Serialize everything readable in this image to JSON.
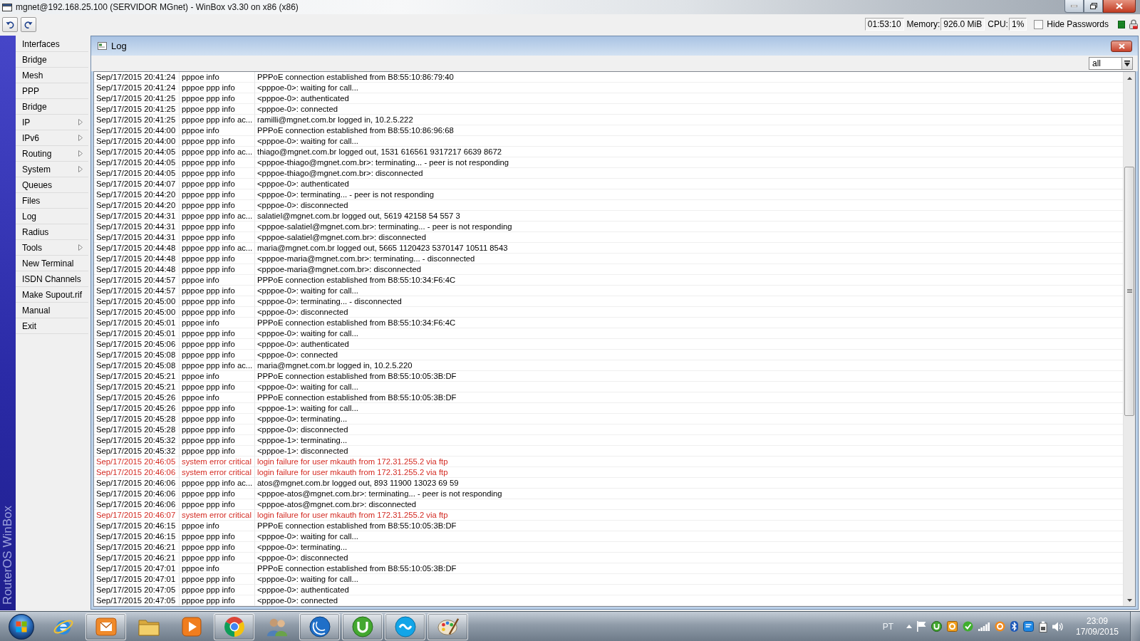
{
  "window": {
    "title": "mgnet@192.168.25.100 (SERVIDOR MGnet) - WinBox v3.30 on x86 (x86)"
  },
  "toolbar": {
    "uptime": "01:53:10",
    "memory_label": "Memory:",
    "memory": "926.0 MiB",
    "cpu_label": "CPU:",
    "cpu": "1%",
    "hide_passwords": {
      "label": "Hide Passwords",
      "checked": false
    }
  },
  "sidebar": {
    "banner": "RouterOS WinBox",
    "items": [
      {
        "label": "Interfaces",
        "submenu": false
      },
      {
        "label": "Bridge",
        "submenu": false
      },
      {
        "label": "Mesh",
        "submenu": false
      },
      {
        "label": "PPP",
        "submenu": false
      },
      {
        "label": "Bridge",
        "submenu": false
      },
      {
        "label": "IP",
        "submenu": true
      },
      {
        "label": "IPv6",
        "submenu": true
      },
      {
        "label": "Routing",
        "submenu": true
      },
      {
        "label": "System",
        "submenu": true
      },
      {
        "label": "Queues",
        "submenu": false
      },
      {
        "label": "Files",
        "submenu": false
      },
      {
        "label": "Log",
        "submenu": false
      },
      {
        "label": "Radius",
        "submenu": false
      },
      {
        "label": "Tools",
        "submenu": true
      },
      {
        "label": "New Terminal",
        "submenu": false
      },
      {
        "label": "ISDN Channels",
        "submenu": false
      },
      {
        "label": "Make Supout.rif",
        "submenu": false
      },
      {
        "label": "Manual",
        "submenu": false
      },
      {
        "label": "Exit",
        "submenu": false
      }
    ]
  },
  "log_window": {
    "title": "Log",
    "filter": {
      "value": "all"
    },
    "table": {
      "rows": [
        {
          "kind": "info",
          "cells": [
            "Sep/17/2015 20:41:24",
            "pppoe info",
            "PPPoE connection established from B8:55:10:86:79:40"
          ]
        },
        {
          "kind": "info",
          "cells": [
            "Sep/17/2015 20:41:24",
            "pppoe ppp info",
            "<pppoe-0>: waiting for call..."
          ]
        },
        {
          "kind": "info",
          "cells": [
            "Sep/17/2015 20:41:25",
            "pppoe ppp info",
            "<pppoe-0>: authenticated"
          ]
        },
        {
          "kind": "info",
          "cells": [
            "Sep/17/2015 20:41:25",
            "pppoe ppp info",
            "<pppoe-0>: connected"
          ]
        },
        {
          "kind": "info",
          "cells": [
            "Sep/17/2015 20:41:25",
            "pppoe ppp info ac...",
            "ramilli@mgnet.com.br logged in, 10.2.5.222"
          ]
        },
        {
          "kind": "info",
          "cells": [
            "Sep/17/2015 20:44:00",
            "pppoe info",
            "PPPoE connection established from B8:55:10:86:96:68"
          ]
        },
        {
          "kind": "info",
          "cells": [
            "Sep/17/2015 20:44:00",
            "pppoe ppp info",
            "<pppoe-0>: waiting for call..."
          ]
        },
        {
          "kind": "info",
          "cells": [
            "Sep/17/2015 20:44:05",
            "pppoe ppp info ac...",
            "thiago@mgnet.com.br logged out, 1531 616561 9317217 6639 8672"
          ]
        },
        {
          "kind": "info",
          "cells": [
            "Sep/17/2015 20:44:05",
            "pppoe ppp info",
            "<pppoe-thiago@mgnet.com.br>: terminating... - peer is not responding"
          ]
        },
        {
          "kind": "info",
          "cells": [
            "Sep/17/2015 20:44:05",
            "pppoe ppp info",
            "<pppoe-thiago@mgnet.com.br>: disconnected"
          ]
        },
        {
          "kind": "info",
          "cells": [
            "Sep/17/2015 20:44:07",
            "pppoe ppp info",
            "<pppoe-0>: authenticated"
          ]
        },
        {
          "kind": "info",
          "cells": [
            "Sep/17/2015 20:44:20",
            "pppoe ppp info",
            "<pppoe-0>: terminating... - peer is not responding"
          ]
        },
        {
          "kind": "info",
          "cells": [
            "Sep/17/2015 20:44:20",
            "pppoe ppp info",
            "<pppoe-0>: disconnected"
          ]
        },
        {
          "kind": "info",
          "cells": [
            "Sep/17/2015 20:44:31",
            "pppoe ppp info ac...",
            "salatiel@mgnet.com.br logged out, 5619 42158 54 557 3"
          ]
        },
        {
          "kind": "info",
          "cells": [
            "Sep/17/2015 20:44:31",
            "pppoe ppp info",
            "<pppoe-salatiel@mgnet.com.br>: terminating... - peer is not responding"
          ]
        },
        {
          "kind": "info",
          "cells": [
            "Sep/17/2015 20:44:31",
            "pppoe ppp info",
            "<pppoe-salatiel@mgnet.com.br>: disconnected"
          ]
        },
        {
          "kind": "info",
          "cells": [
            "Sep/17/2015 20:44:48",
            "pppoe ppp info ac...",
            "maria@mgnet.com.br logged out, 5665 1120423 5370147 10511 8543"
          ]
        },
        {
          "kind": "info",
          "cells": [
            "Sep/17/2015 20:44:48",
            "pppoe ppp info",
            "<pppoe-maria@mgnet.com.br>: terminating... - disconnected"
          ]
        },
        {
          "kind": "info",
          "cells": [
            "Sep/17/2015 20:44:48",
            "pppoe ppp info",
            "<pppoe-maria@mgnet.com.br>: disconnected"
          ]
        },
        {
          "kind": "info",
          "cells": [
            "Sep/17/2015 20:44:57",
            "pppoe info",
            "PPPoE connection established from B8:55:10:34:F6:4C"
          ]
        },
        {
          "kind": "info",
          "cells": [
            "Sep/17/2015 20:44:57",
            "pppoe ppp info",
            "<pppoe-0>: waiting for call..."
          ]
        },
        {
          "kind": "info",
          "cells": [
            "Sep/17/2015 20:45:00",
            "pppoe ppp info",
            "<pppoe-0>: terminating... - disconnected"
          ]
        },
        {
          "kind": "info",
          "cells": [
            "Sep/17/2015 20:45:00",
            "pppoe ppp info",
            "<pppoe-0>: disconnected"
          ]
        },
        {
          "kind": "info",
          "cells": [
            "Sep/17/2015 20:45:01",
            "pppoe info",
            "PPPoE connection established from B8:55:10:34:F6:4C"
          ]
        },
        {
          "kind": "info",
          "cells": [
            "Sep/17/2015 20:45:01",
            "pppoe ppp info",
            "<pppoe-0>: waiting for call..."
          ]
        },
        {
          "kind": "info",
          "cells": [
            "Sep/17/2015 20:45:06",
            "pppoe ppp info",
            "<pppoe-0>: authenticated"
          ]
        },
        {
          "kind": "info",
          "cells": [
            "Sep/17/2015 20:45:08",
            "pppoe ppp info",
            "<pppoe-0>: connected"
          ]
        },
        {
          "kind": "info",
          "cells": [
            "Sep/17/2015 20:45:08",
            "pppoe ppp info ac...",
            "maria@mgnet.com.br logged in, 10.2.5.220"
          ]
        },
        {
          "kind": "info",
          "cells": [
            "Sep/17/2015 20:45:21",
            "pppoe info",
            "PPPoE connection established from B8:55:10:05:3B:DF"
          ]
        },
        {
          "kind": "info",
          "cells": [
            "Sep/17/2015 20:45:21",
            "pppoe ppp info",
            "<pppoe-0>: waiting for call..."
          ]
        },
        {
          "kind": "info",
          "cells": [
            "Sep/17/2015 20:45:26",
            "pppoe info",
            "PPPoE connection established from B8:55:10:05:3B:DF"
          ]
        },
        {
          "kind": "info",
          "cells": [
            "Sep/17/2015 20:45:26",
            "pppoe ppp info",
            "<pppoe-1>: waiting for call..."
          ]
        },
        {
          "kind": "info",
          "cells": [
            "Sep/17/2015 20:45:28",
            "pppoe ppp info",
            "<pppoe-0>: terminating..."
          ]
        },
        {
          "kind": "info",
          "cells": [
            "Sep/17/2015 20:45:28",
            "pppoe ppp info",
            "<pppoe-0>: disconnected"
          ]
        },
        {
          "kind": "info",
          "cells": [
            "Sep/17/2015 20:45:32",
            "pppoe ppp info",
            "<pppoe-1>: terminating..."
          ]
        },
        {
          "kind": "info",
          "cells": [
            "Sep/17/2015 20:45:32",
            "pppoe ppp info",
            "<pppoe-1>: disconnected"
          ]
        },
        {
          "kind": "error",
          "cells": [
            "Sep/17/2015 20:46:05",
            "system error critical",
            "login failure for user mkauth from 172.31.255.2 via ftp"
          ]
        },
        {
          "kind": "error",
          "cells": [
            "Sep/17/2015 20:46:06",
            "system error critical",
            "login failure for user mkauth from 172.31.255.2 via ftp"
          ]
        },
        {
          "kind": "info",
          "cells": [
            "Sep/17/2015 20:46:06",
            "pppoe ppp info ac...",
            "atos@mgnet.com.br logged out, 893 11900 13023 69 59"
          ]
        },
        {
          "kind": "info",
          "cells": [
            "Sep/17/2015 20:46:06",
            "pppoe ppp info",
            "<pppoe-atos@mgnet.com.br>: terminating... - peer is not responding"
          ]
        },
        {
          "kind": "info",
          "cells": [
            "Sep/17/2015 20:46:06",
            "pppoe ppp info",
            "<pppoe-atos@mgnet.com.br>: disconnected"
          ]
        },
        {
          "kind": "error",
          "cells": [
            "Sep/17/2015 20:46:07",
            "system error critical",
            "login failure for user mkauth from 172.31.255.2 via ftp"
          ]
        },
        {
          "kind": "info",
          "cells": [
            "Sep/17/2015 20:46:15",
            "pppoe info",
            "PPPoE connection established from B8:55:10:05:3B:DF"
          ]
        },
        {
          "kind": "info",
          "cells": [
            "Sep/17/2015 20:46:15",
            "pppoe ppp info",
            "<pppoe-0>: waiting for call..."
          ]
        },
        {
          "kind": "info",
          "cells": [
            "Sep/17/2015 20:46:21",
            "pppoe ppp info",
            "<pppoe-0>: terminating..."
          ]
        },
        {
          "kind": "info",
          "cells": [
            "Sep/17/2015 20:46:21",
            "pppoe ppp info",
            "<pppoe-0>: disconnected"
          ]
        },
        {
          "kind": "info",
          "cells": [
            "Sep/17/2015 20:47:01",
            "pppoe info",
            "PPPoE connection established from B8:55:10:05:3B:DF"
          ]
        },
        {
          "kind": "info",
          "cells": [
            "Sep/17/2015 20:47:01",
            "pppoe ppp info",
            "<pppoe-0>: waiting for call..."
          ]
        },
        {
          "kind": "info",
          "cells": [
            "Sep/17/2015 20:47:05",
            "pppoe ppp info",
            "<pppoe-0>: authenticated"
          ]
        },
        {
          "kind": "info",
          "cells": [
            "Sep/17/2015 20:47:05",
            "pppoe ppp info",
            "<pppoe-0>: connected"
          ]
        }
      ]
    }
  },
  "taskbar": {
    "apps": [
      {
        "kind": "browser",
        "running": false
      },
      {
        "kind": "mail",
        "running": true
      },
      {
        "kind": "folder",
        "running": false
      },
      {
        "kind": "player",
        "running": false
      },
      {
        "kind": "wheel",
        "running": true
      },
      {
        "kind": "people",
        "running": false
      },
      {
        "kind": "arcs",
        "running": true
      },
      {
        "kind": "torrent",
        "running": true
      },
      {
        "kind": "chat",
        "running": true
      },
      {
        "kind": "paint",
        "running": true
      }
    ],
    "tray": {
      "language": "PT",
      "time": "23:09",
      "date": "17/09/2015"
    }
  }
}
